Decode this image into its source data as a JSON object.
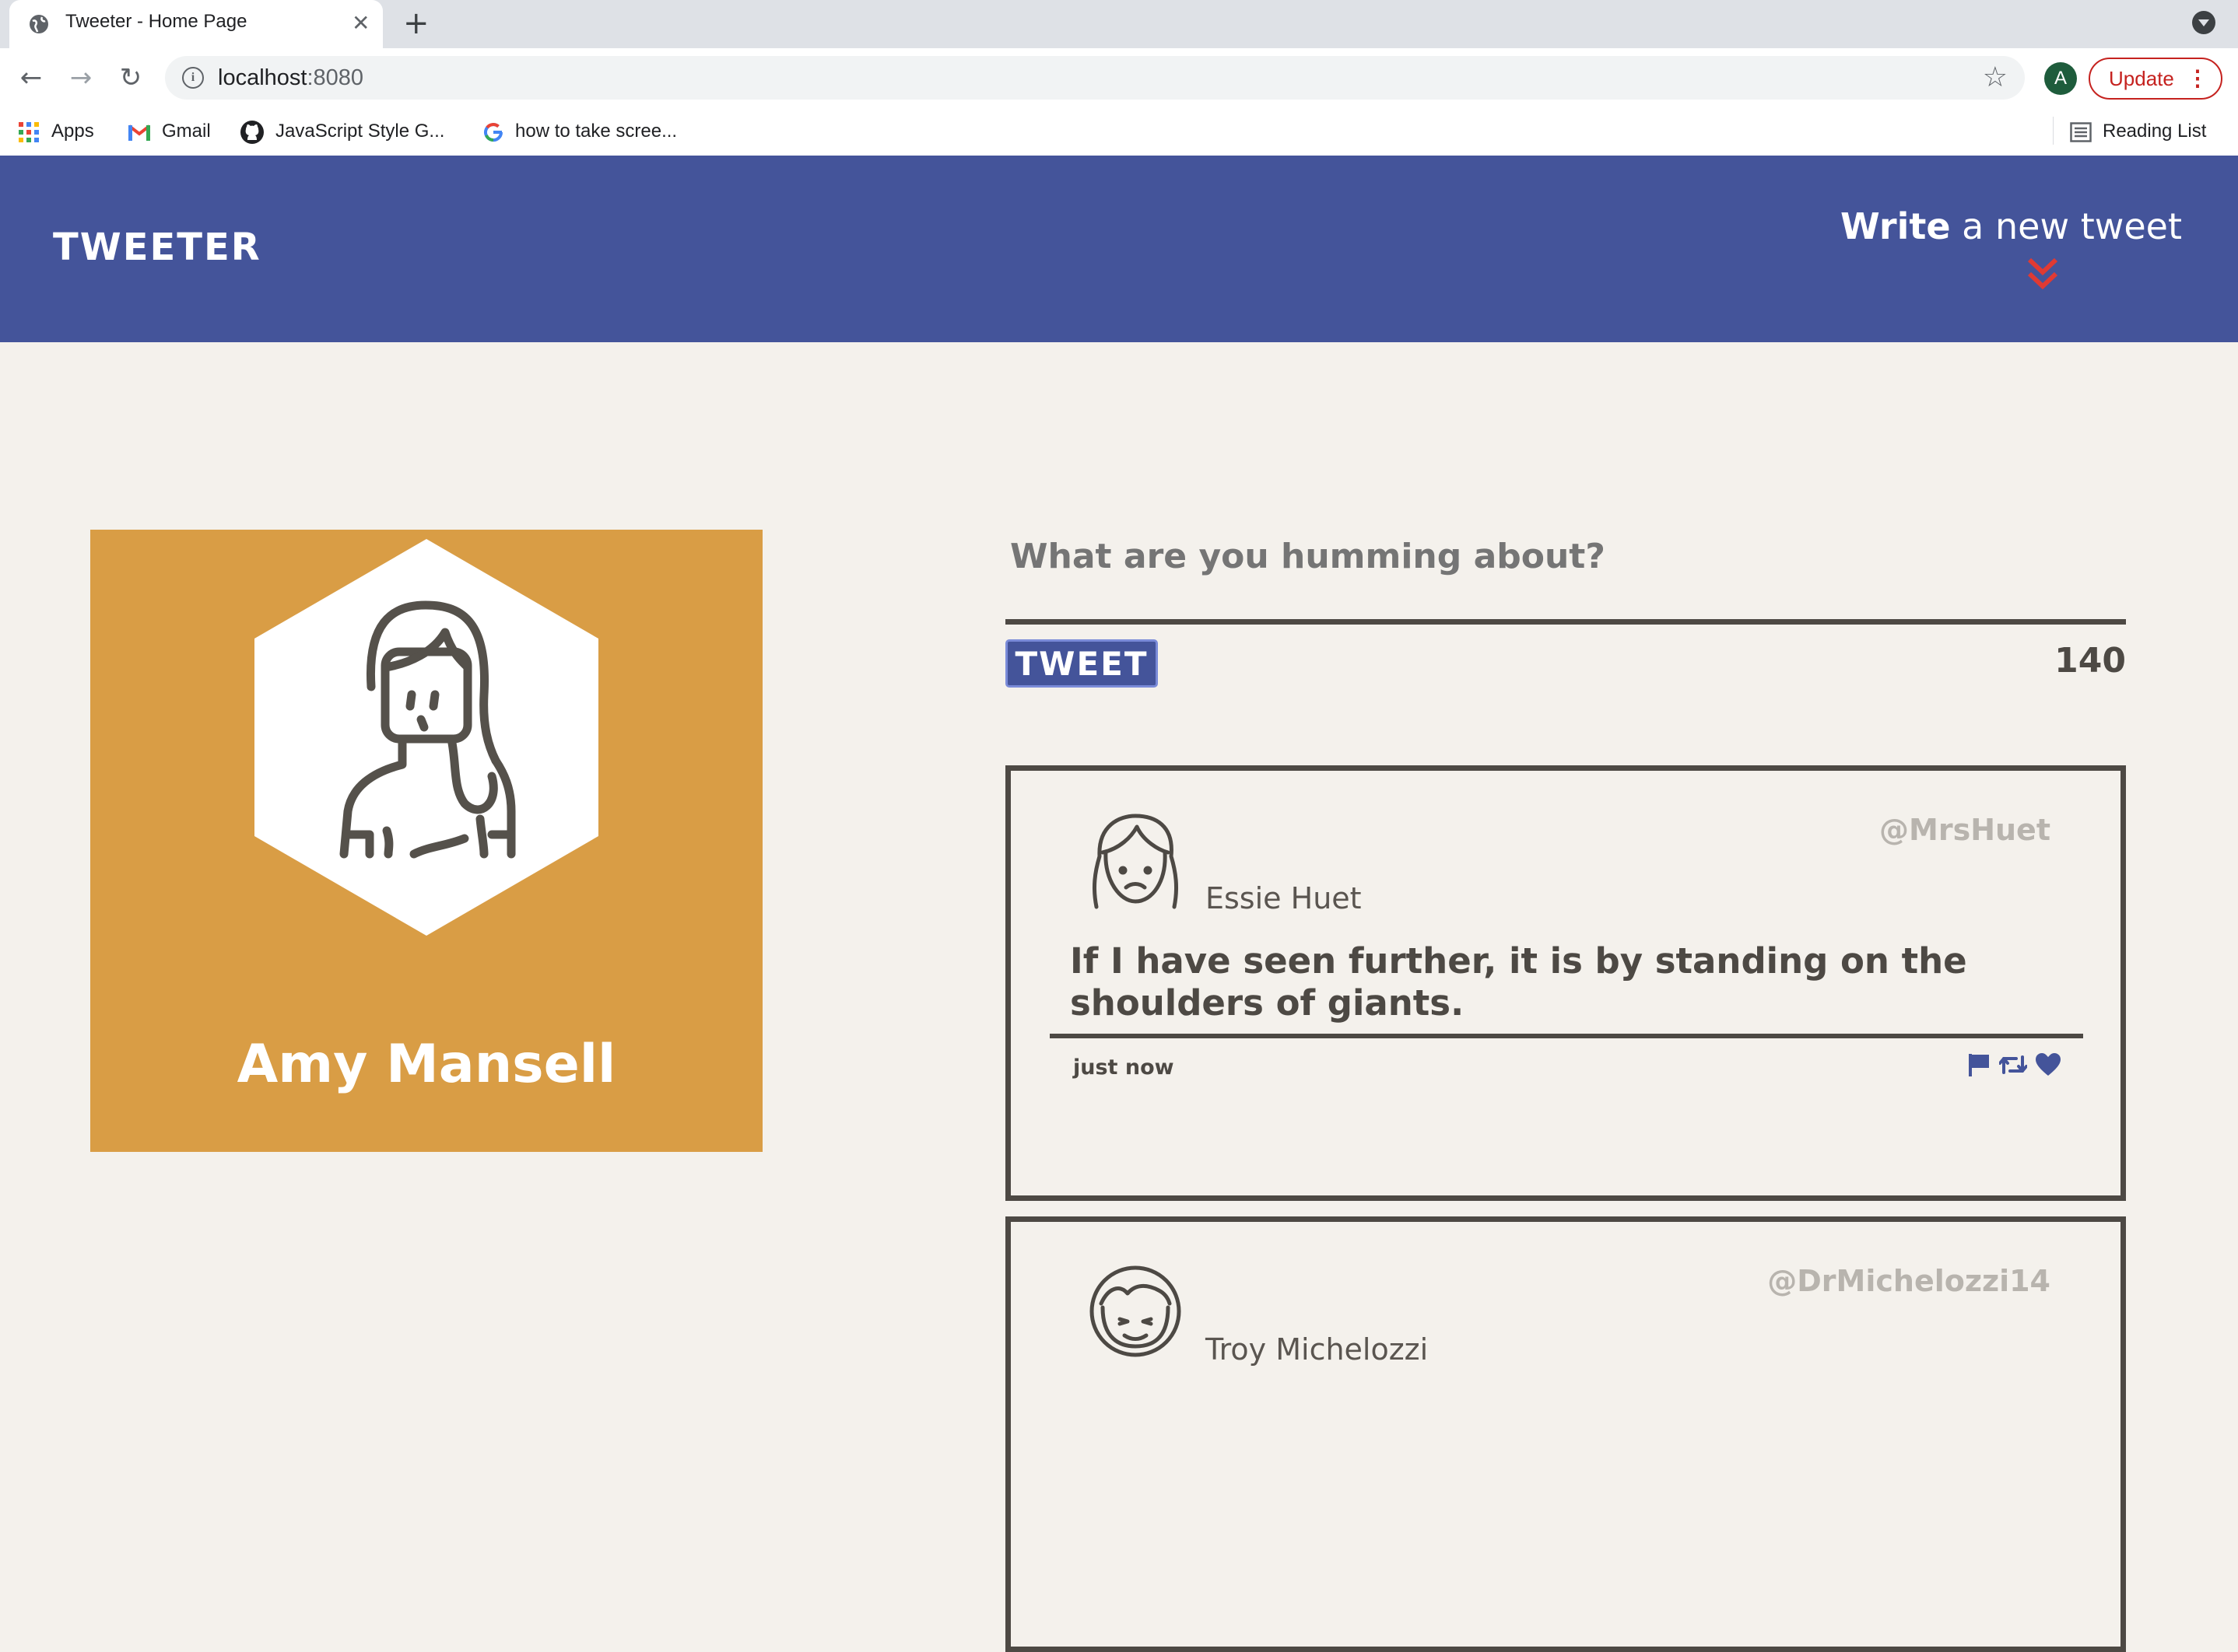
{
  "browser": {
    "tab_title": "Tweeter - Home Page",
    "url_host": "localhost",
    "url_port": ":8080",
    "profile_initial": "A",
    "update_label": "Update",
    "bookmarks": [
      "Apps",
      "Gmail",
      "JavaScript Style G...",
      "how to take scree..."
    ],
    "reading_list": "Reading List"
  },
  "header": {
    "brand": "TWEETER",
    "write_bold": "Write",
    "write_rest": " a new tweet"
  },
  "profile": {
    "name": "Amy Mansell",
    "card_color": "#d99d45"
  },
  "compose": {
    "placeholder": "What are you humming about?",
    "button_label": "TWEET",
    "counter": "140"
  },
  "tweets": [
    {
      "name": "Essie Huet",
      "handle": "@MrsHuet",
      "text": "If I have seen further, it is by standing on the shoulders of giants.",
      "time": "just now"
    },
    {
      "name": "Troy Michelozzi",
      "handle": "@DrMichelozzi14"
    }
  ],
  "colors": {
    "header_bg": "#44549a",
    "page_bg": "#f4f1ec",
    "text_dark": "#4d4944",
    "accent_red": "#e03a33"
  }
}
